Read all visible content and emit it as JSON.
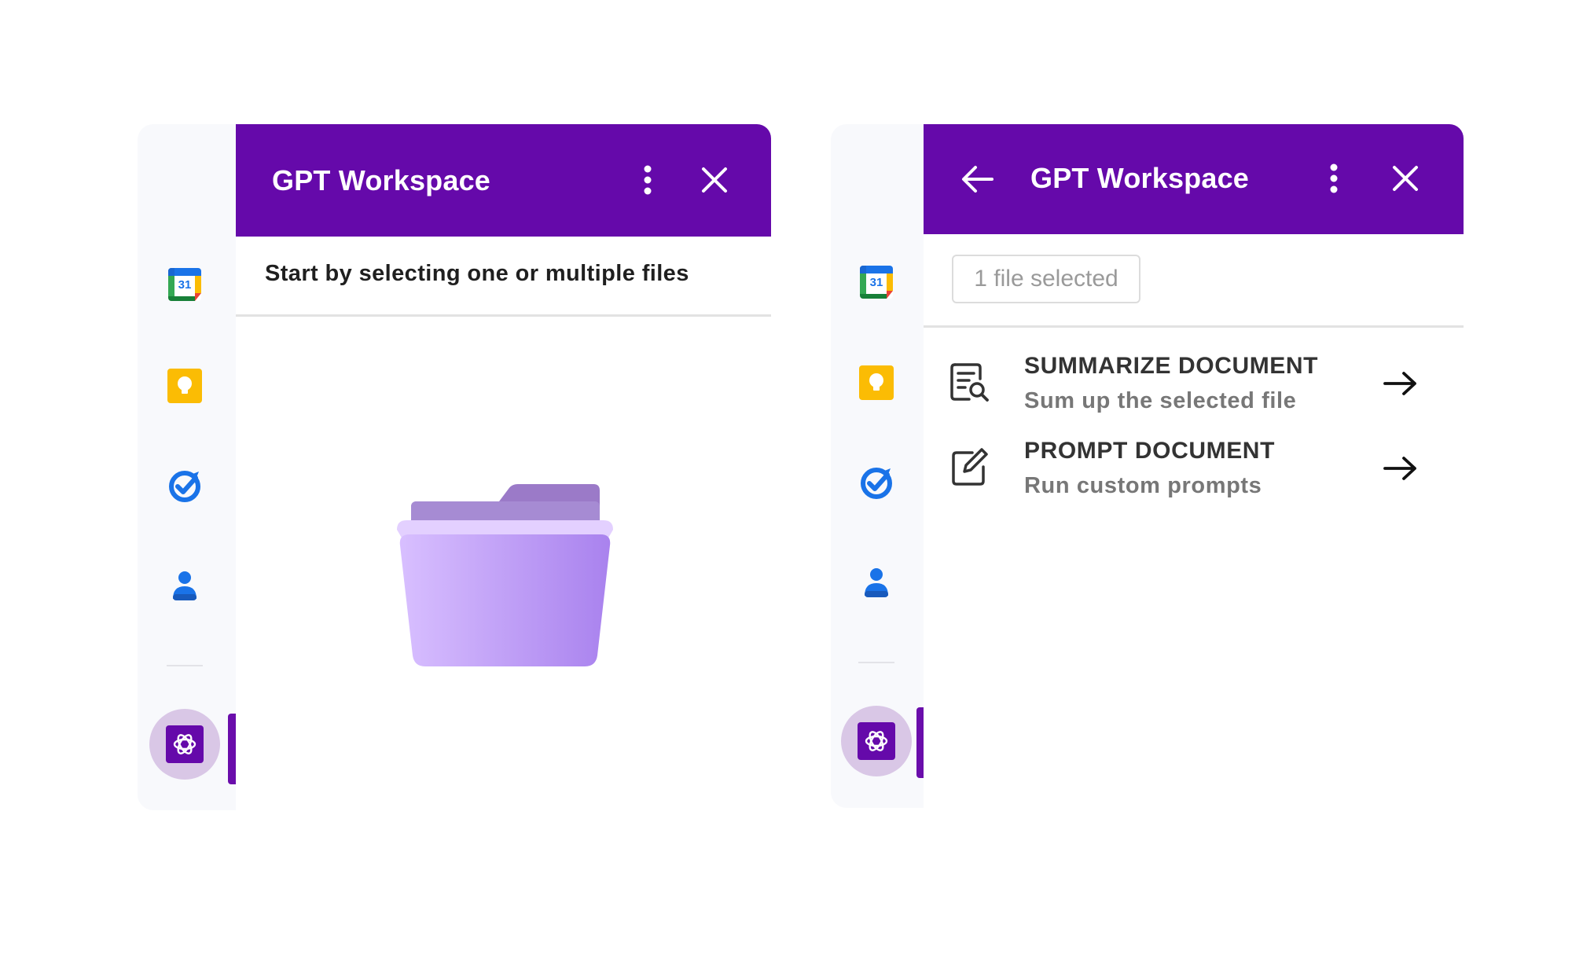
{
  "left_panel": {
    "header": {
      "title": "GPT Workspace"
    },
    "subtitle": "Start by selecting one or multiple files",
    "empty_state_icon": "folder-icon"
  },
  "right_panel": {
    "header": {
      "title": "GPT Workspace"
    },
    "file_chip": "1 file selected",
    "actions": [
      {
        "title": "SUMMARIZE DOCUMENT",
        "subtitle": "Sum up the selected file",
        "icon": "document-search-icon"
      },
      {
        "title": "PROMPT DOCUMENT",
        "subtitle": "Run custom prompts",
        "icon": "edit-icon"
      }
    ]
  },
  "rail": {
    "items": [
      {
        "name": "calendar",
        "label": "31",
        "icon": "calendar-icon"
      },
      {
        "name": "keep",
        "icon": "lightbulb-icon"
      },
      {
        "name": "tasks",
        "icon": "tasks-check-icon"
      },
      {
        "name": "contacts",
        "icon": "person-icon"
      },
      {
        "name": "gpt-workspace",
        "icon": "openai-icon"
      }
    ]
  },
  "colors": {
    "header": "#6509aa",
    "accent": "#6a0dab",
    "rail_bg": "#f8f9fc",
    "active_bg": "#d9c7e6"
  }
}
